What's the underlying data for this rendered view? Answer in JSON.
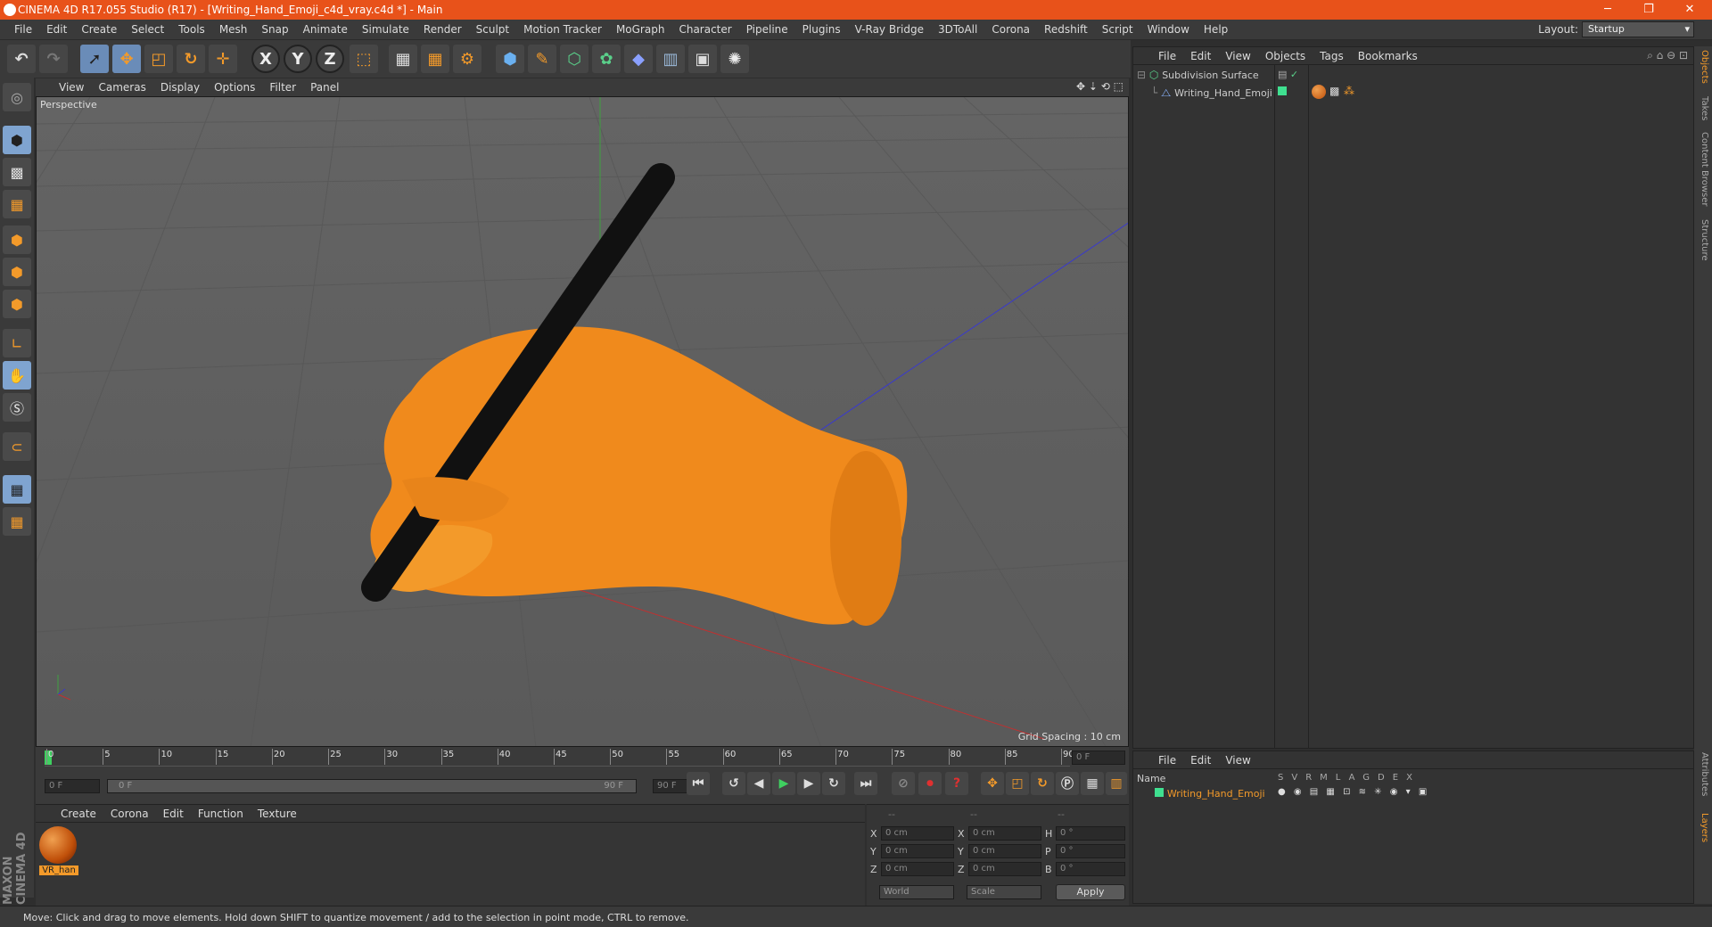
{
  "app": {
    "title": "CINEMA 4D R17.055 Studio (R17) - [Writing_Hand_Emoji_c4d_vray.c4d *] - Main"
  },
  "menu": [
    "File",
    "Edit",
    "Create",
    "Select",
    "Tools",
    "Mesh",
    "Snap",
    "Animate",
    "Simulate",
    "Render",
    "Sculpt",
    "Motion Tracker",
    "MoGraph",
    "Character",
    "Pipeline",
    "Plugins",
    "V-Ray Bridge",
    "3DToAll",
    "Corona",
    "Redshift",
    "Script",
    "Window",
    "Help"
  ],
  "layout": {
    "label": "Layout:",
    "value": "Startup"
  },
  "viewport": {
    "menu": [
      "View",
      "Cameras",
      "Display",
      "Options",
      "Filter",
      "Panel"
    ],
    "label": "Perspective",
    "grid_spacing": "Grid Spacing : 10 cm"
  },
  "toolbar_axes": [
    "X",
    "Y",
    "Z"
  ],
  "timeline": {
    "ticks": [
      "0",
      "5",
      "10",
      "15",
      "20",
      "25",
      "30",
      "35",
      "40",
      "45",
      "50",
      "55",
      "60",
      "65",
      "70",
      "75",
      "80",
      "85",
      "90"
    ],
    "current_frame": "0 F",
    "start": "0 F",
    "slider_start": "0 F",
    "slider_end": "90 F",
    "end": "90 F"
  },
  "objects_panel": {
    "menu": [
      "File",
      "Edit",
      "View",
      "Objects",
      "Tags",
      "Bookmarks"
    ],
    "items": [
      {
        "name": "Subdivision Surface"
      },
      {
        "name": "Writing_Hand_Emoji"
      }
    ]
  },
  "layers_panel": {
    "menu": [
      "File",
      "Edit",
      "View"
    ],
    "col_name": "Name",
    "cols": [
      "S",
      "V",
      "R",
      "M",
      "L",
      "A",
      "G",
      "D",
      "E",
      "X"
    ],
    "row": "Writing_Hand_Emoji"
  },
  "material_panel": {
    "menu": [
      "Create",
      "Corona",
      "Edit",
      "Function",
      "Texture"
    ],
    "material_name": "VR_han"
  },
  "coords": {
    "header": [
      "--",
      "--",
      "--"
    ],
    "rows": [
      {
        "a": "X",
        "av": "0 cm",
        "b": "X",
        "bv": "0 cm",
        "c": "H",
        "cv": "0 °"
      },
      {
        "a": "Y",
        "av": "0 cm",
        "b": "Y",
        "bv": "0 cm",
        "c": "P",
        "cv": "0 °"
      },
      {
        "a": "Z",
        "av": "0 cm",
        "b": "Z",
        "bv": "0 cm",
        "c": "B",
        "cv": "0 °"
      }
    ],
    "space": "World",
    "mode": "Scale",
    "apply": "Apply"
  },
  "right_tabs": [
    "Objects",
    "Takes",
    "Content Browser",
    "Structure",
    "Attributes",
    "Layers"
  ],
  "status": "Move: Click and drag to move elements. Hold down SHIFT to quantize movement / add to the selection in point mode, CTRL to remove.",
  "brand": "MAXON CINEMA 4D",
  "colors": {
    "accent": "#e8521a",
    "hand": "#f08a1c",
    "pen": "#111111"
  }
}
